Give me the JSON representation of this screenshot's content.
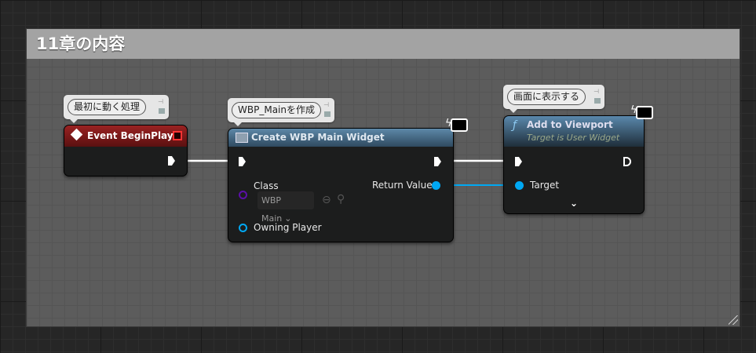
{
  "comment": {
    "title": "11章の内容"
  },
  "nodes": {
    "begin_play": {
      "comment": "最初に動く処理",
      "title": "Event BeginPlay"
    },
    "create_widget": {
      "comment": "WBP_Mainを作成",
      "title": "Create WBP Main Widget",
      "class_label": "Class",
      "class_value": "WBP Main",
      "owning_player": "Owning Player",
      "return_value": "Return Value"
    },
    "add_to_viewport": {
      "comment": "画面に表示する",
      "title": "Add to Viewport",
      "subtitle": "Target is User Widget",
      "function_glyph": "ƒ",
      "target": "Target"
    }
  },
  "colors": {
    "exec": "#ffffff",
    "object": "#00a8f3",
    "class": "#5b0fa8",
    "event_header": "#8b1a1a",
    "func_header": "#4a7090"
  }
}
